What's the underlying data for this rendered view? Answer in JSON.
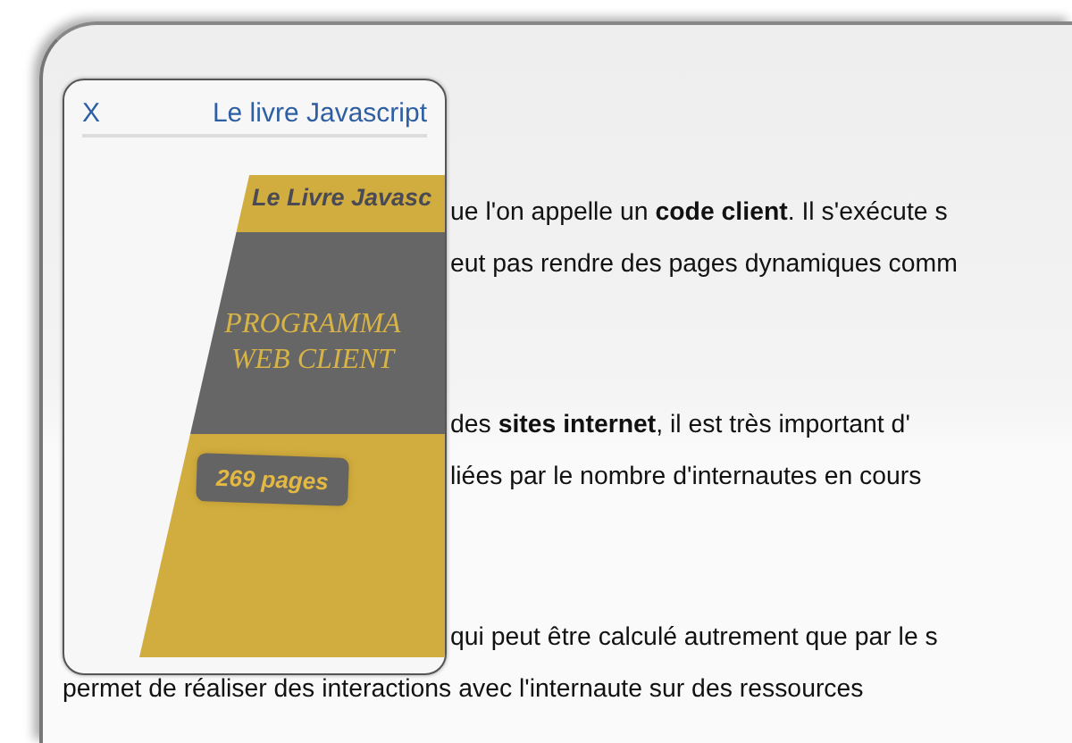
{
  "panel": {
    "close": "X",
    "title": "Le livre Javascript",
    "book": {
      "brand": "Le Livre Javasc",
      "title_lines": [
        "PROGRAMMA",
        "WEB CLIENT"
      ],
      "badge": "269 pages"
    }
  },
  "paragraphs": [
    {
      "kind": "beside",
      "lines": [
        "ue l'on appelle un **code client**. Il s'exécute s",
        "eut pas rendre des pages dynamiques comm"
      ]
    },
    {
      "kind": "beside",
      "lines": [
        "des **sites internet**, il est très important d'",
        "liées par le nombre d'internautes en cours"
      ]
    },
    {
      "kind": "beside",
      "lines": [
        "qui peut être calculé autrement que par le s"
      ]
    },
    {
      "kind": "below",
      "lines": [
        "permet de réaliser des interactions avec l'internaute sur des ressources"
      ]
    }
  ]
}
